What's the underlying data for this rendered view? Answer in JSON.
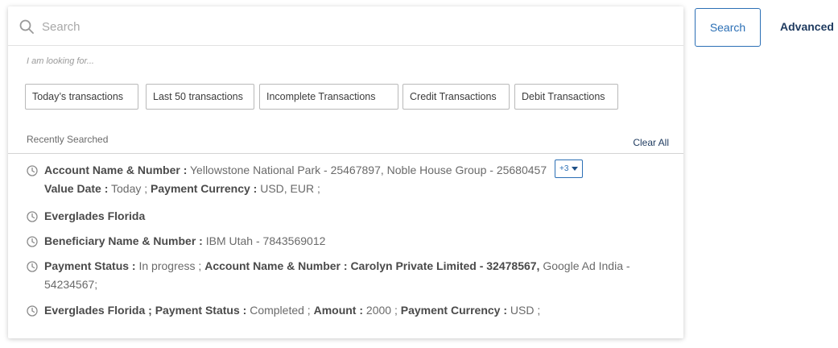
{
  "search": {
    "placeholder": "Search",
    "button_label": "Search",
    "advanced_label": "Advanced",
    "icon": "search-icon"
  },
  "suggestions": {
    "hint": "I am looking for...",
    "chips": [
      "Today’s transactions",
      "Last 50 transactions",
      "Incomplete Transactions",
      "Credit Transactions",
      "Debit Transactions"
    ]
  },
  "recent": {
    "label": "Recently Searched",
    "clear_all": "Clear All",
    "item_icon": "clock-icon",
    "items": [
      {
        "l1_label1": "Account Name & Number :",
        "l1_value1": "Yellowstone National Park - 25467897, Noble House Group - 25680457",
        "more": "+3",
        "l2_label1": "Value Date :",
        "l2_value1": "Today ;",
        "l2_label2": "Payment Currency :",
        "l2_value2": "USD, EUR ;"
      },
      {
        "text": "Everglades Florida"
      },
      {
        "label1": "Beneficiary Name & Number :",
        "value1": "IBM Utah - 7843569012"
      },
      {
        "label1": "Payment Status :",
        "value1": "In progress ;",
        "label2": "Account Name & Number : Carolyn Private Limited  - 32478567,",
        "value2": "Google Ad India -",
        "l2_value": "54234567;"
      },
      {
        "label1": "Everglades Florida ;",
        "label2": "Payment Status :",
        "value2": "Completed ;",
        "label3": "Amount :",
        "value3": "2000 ;",
        "label4": "Payment Currency :",
        "value4": "USD ;"
      }
    ]
  },
  "colors": {
    "accent": "#2b6fb5",
    "link": "#1e3a5f",
    "text": "#6a6a6a"
  }
}
